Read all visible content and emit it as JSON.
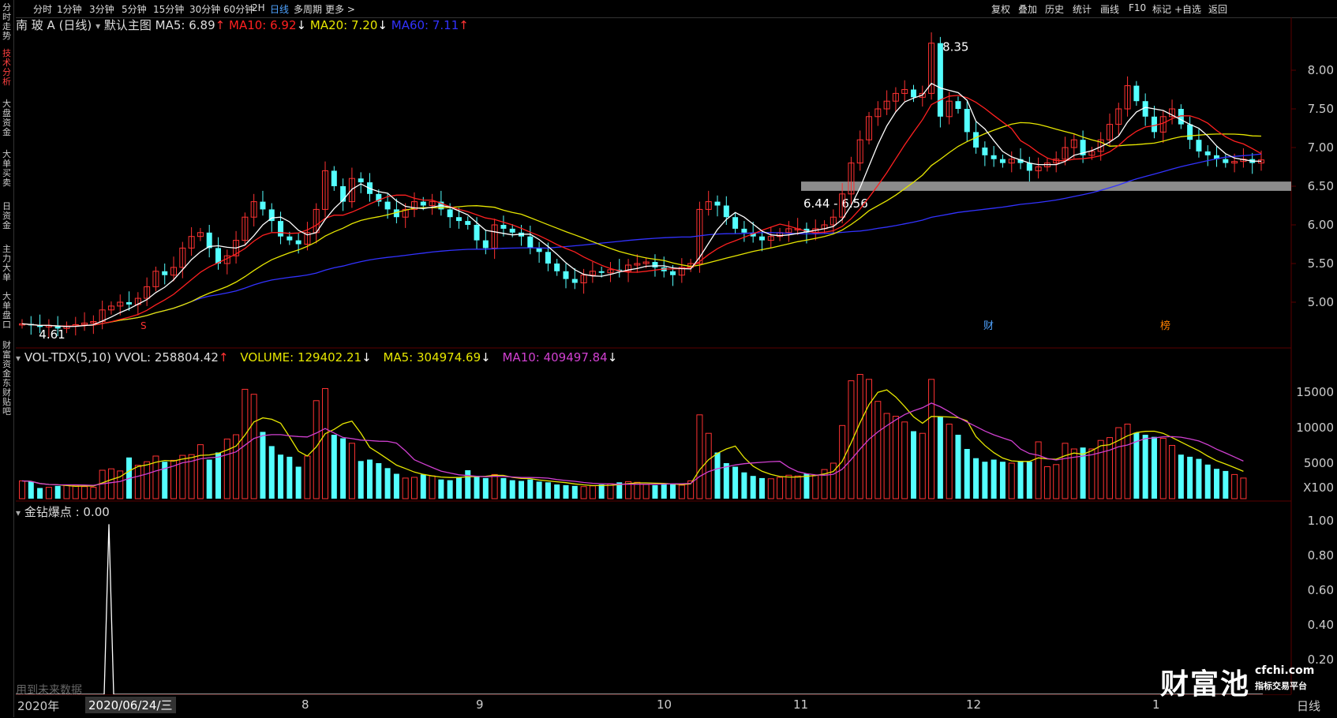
{
  "topbar": {
    "periods": [
      "分时",
      "1分钟",
      "3分钟",
      "5分钟",
      "15分钟",
      "30分钟",
      "60分钟",
      "2H",
      "日线",
      "多周期",
      "更多 >"
    ],
    "active_period": "日线",
    "right_buttons": [
      "复权",
      "叠加",
      "历史",
      "统计",
      "画线",
      "F10",
      "标记",
      "+自选",
      "返回"
    ]
  },
  "leftbar": {
    "tabs": [
      "分时走势",
      "技术分析",
      "大盘资金",
      "大单买卖",
      "日资金",
      "主力大单",
      "大单盘口",
      "财富资金",
      "东财贴吧"
    ],
    "active": "技术分析"
  },
  "main": {
    "stock_title": "南 玻 A (日线)",
    "indicator_name": "默认主图",
    "ma5": "MA5: 6.89",
    "ma10": "MA10: 6.92",
    "ma20": "MA20: 7.20",
    "ma60": "MA60: 7.11",
    "high_label": "8.35",
    "low_label": "4.61",
    "zone_label": "6.44 - 6.56",
    "markers": {
      "s": "S",
      "cai": "财",
      "bang": "榜"
    },
    "y_ticks": [
      "8.00",
      "7.50",
      "7.00",
      "6.50",
      "6.00",
      "5.50",
      "5.00"
    ],
    "y_tick_values": [
      8.0,
      7.5,
      7.0,
      6.5,
      6.0,
      5.5,
      5.0
    ]
  },
  "volume": {
    "title": "VOL-TDX(5,10) VVOL: 258804.42",
    "volume": "VOLUME: 129402.21",
    "ma5": "MA5: 304974.69",
    "ma10": "MA10: 409497.84",
    "y_ticks": [
      "15000",
      "10000",
      "5000"
    ],
    "y_tick_values": [
      15000,
      10000,
      5000
    ],
    "unit": "X100"
  },
  "indicator": {
    "title": "金钻爆点 : 0.00",
    "y_ticks": [
      "1.00",
      "0.80",
      "0.60",
      "0.40",
      "0.20"
    ],
    "y_tick_values": [
      1.0,
      0.8,
      0.6,
      0.4,
      0.2
    ],
    "footnote": "用到未来数据"
  },
  "date_axis": {
    "year": "2020年",
    "cursor_date": "2020/06/24/三",
    "months": [
      "8",
      "9",
      "10",
      "11",
      "12",
      "1"
    ],
    "period_label": "日线"
  },
  "watermark": {
    "name": "财富池",
    "domain": "cfchi.com",
    "slogan": "指标交易平台"
  },
  "colors": {
    "up": "#ff3232",
    "down": "#54ffff",
    "ma5": "#ffffff",
    "ma10": "#ff2020",
    "ma20": "#e6e600",
    "ma60": "#3232ff",
    "vma10": "#d040d0",
    "highlight_bar": "#8c8c8c"
  },
  "chart_data": {
    "type": "candlestick",
    "price_range": [
      4.5,
      8.5
    ],
    "closes": [
      4.72,
      4.7,
      4.68,
      4.7,
      4.66,
      4.69,
      4.71,
      4.73,
      4.75,
      4.9,
      4.95,
      5.0,
      4.97,
      5.05,
      5.2,
      5.4,
      5.35,
      5.45,
      5.7,
      5.85,
      5.9,
      5.7,
      5.5,
      5.6,
      5.8,
      6.1,
      6.3,
      6.2,
      6.05,
      5.85,
      5.8,
      5.75,
      5.9,
      6.2,
      6.7,
      6.5,
      6.3,
      6.6,
      6.55,
      6.4,
      6.3,
      6.2,
      6.1,
      6.2,
      6.3,
      6.25,
      6.3,
      6.2,
      6.1,
      6.05,
      6.0,
      5.8,
      5.7,
      6.0,
      5.95,
      5.9,
      5.85,
      5.7,
      5.65,
      5.5,
      5.4,
      5.3,
      5.25,
      5.35,
      5.4,
      5.38,
      5.42,
      5.4,
      5.48,
      5.5,
      5.52,
      5.45,
      5.4,
      5.35,
      5.45,
      5.5,
      6.2,
      6.3,
      6.25,
      6.1,
      5.95,
      5.9,
      5.85,
      5.8,
      5.85,
      5.9,
      5.95,
      5.95,
      5.9,
      5.95,
      6.0,
      6.1,
      6.4,
      6.8,
      7.1,
      7.4,
      7.5,
      7.6,
      7.7,
      7.75,
      7.65,
      7.7,
      8.35,
      7.4,
      7.6,
      7.5,
      7.2,
      7.0,
      6.9,
      6.85,
      6.8,
      6.85,
      6.8,
      6.7,
      6.75,
      6.8,
      6.85,
      7.0,
      7.1,
      6.9,
      6.95,
      7.1,
      7.3,
      7.5,
      7.8,
      7.6,
      7.4,
      7.2,
      7.4,
      7.5,
      7.3,
      7.1,
      6.95,
      6.9,
      6.85,
      6.8,
      6.82,
      6.85,
      6.8,
      6.84
    ],
    "volumes": [
      2500,
      2400,
      1500,
      1600,
      1800,
      1900,
      1900,
      1700,
      1600,
      4000,
      4200,
      3900,
      5800,
      4700,
      5200,
      6000,
      5200,
      5400,
      6100,
      6200,
      7600,
      5500,
      6500,
      8400,
      9000,
      15400,
      14700,
      9400,
      7400,
      6200,
      5900,
      4500,
      6000,
      13800,
      15500,
      9000,
      8500,
      7800,
      5300,
      5500,
      5000,
      4300,
      3500,
      2900,
      3000,
      3400,
      3200,
      2700,
      2600,
      3000,
      4000,
      3200,
      2900,
      3400,
      2900,
      2600,
      2500,
      2700,
      2400,
      2300,
      2000,
      1900,
      1800,
      1700,
      1800,
      2000,
      2100,
      2300,
      2400,
      2300,
      2000,
      1900,
      2100,
      2000,
      1900,
      2500,
      11800,
      9200,
      6500,
      5000,
      4500,
      3700,
      3200,
      2900,
      2800,
      3000,
      3300,
      3200,
      3500,
      3300,
      4100,
      5000,
      10300,
      16600,
      17500,
      16800,
      13700,
      12000,
      11600,
      10800,
      9500,
      9200,
      16800,
      11500,
      10500,
      9000,
      7000,
      5700,
      5200,
      5500,
      5200,
      5000,
      5300,
      5200,
      8000,
      4500,
      4800,
      7800,
      7000,
      7200,
      7000,
      8200,
      8600,
      10000,
      10500,
      9300,
      9000,
      8700,
      8500,
      7500,
      6200,
      5900,
      5600,
      4800,
      4200,
      3900,
      3400,
      2900
    ]
  }
}
